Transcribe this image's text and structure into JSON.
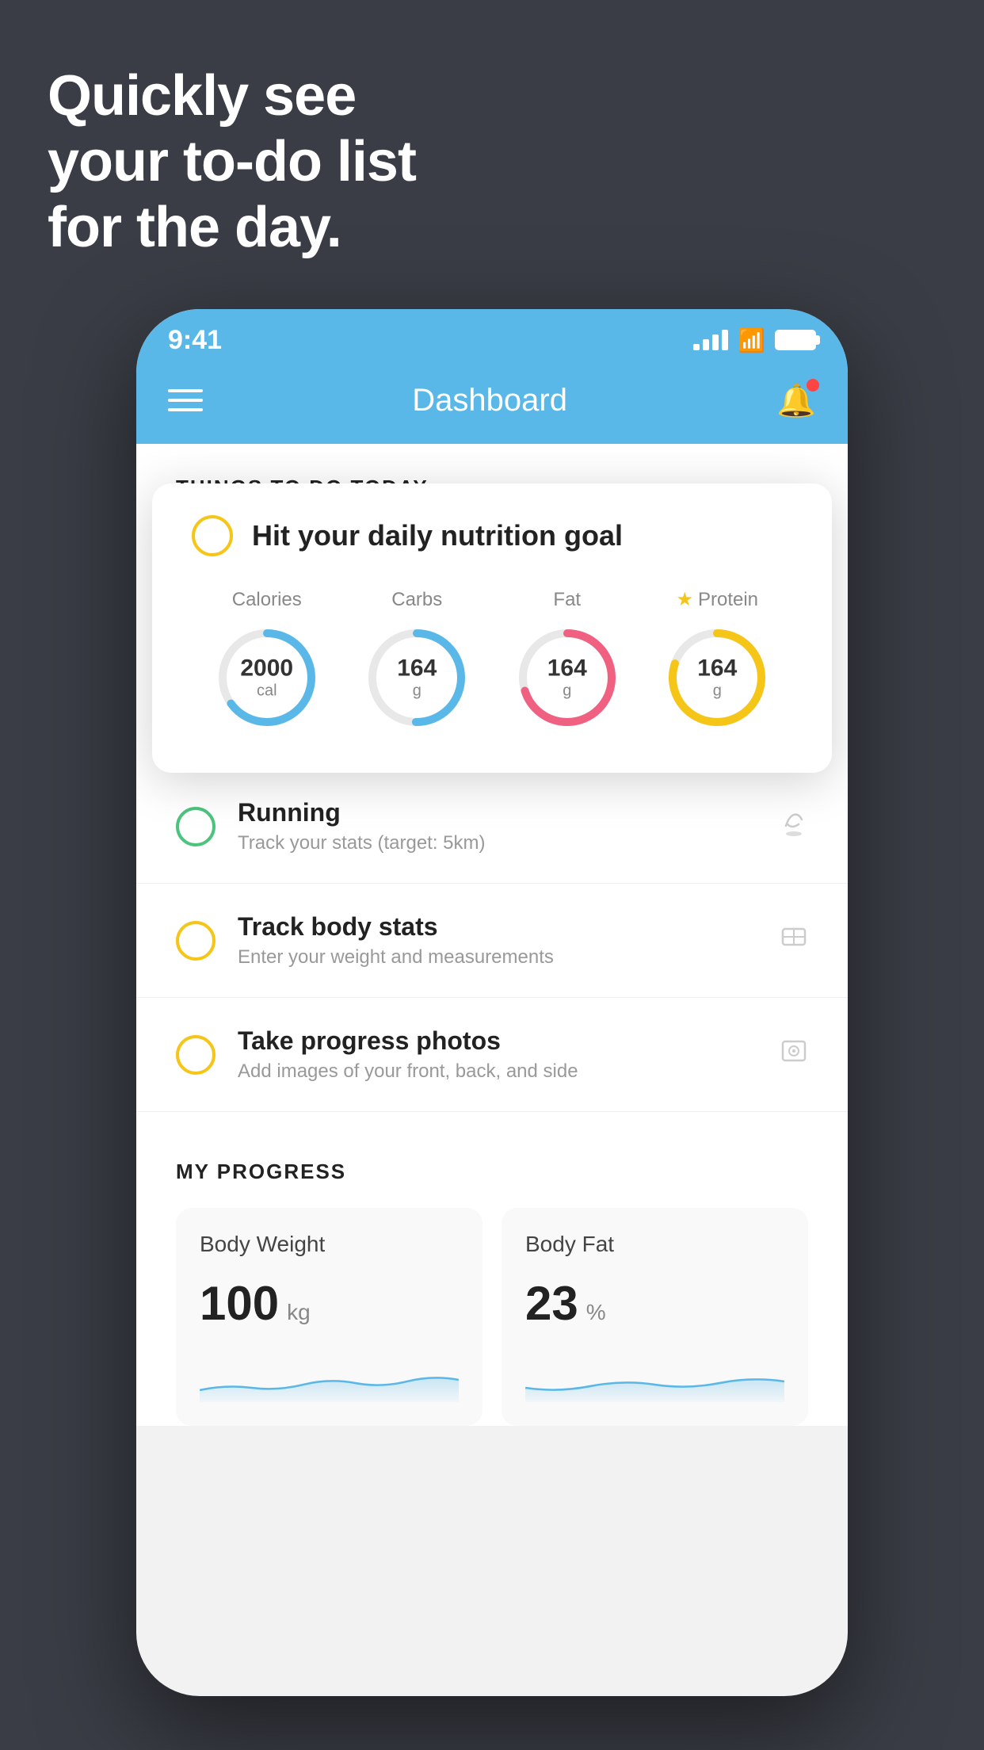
{
  "background_color": "#3a3d45",
  "hero": {
    "line1": "Quickly see",
    "line2": "your to-do list",
    "line3": "for the day."
  },
  "phone": {
    "status_bar": {
      "time": "9:41",
      "signal_bars": [
        12,
        18,
        24,
        30
      ],
      "battery_full": true
    },
    "nav": {
      "title": "Dashboard",
      "has_notification": true
    },
    "section_title": "THINGS TO DO TODAY",
    "floating_card": {
      "check_color": "#f5c518",
      "title": "Hit your daily nutrition goal",
      "nutrients": [
        {
          "label": "Calories",
          "value": "2000",
          "unit": "cal",
          "color": "#5ab8e8",
          "progress": 0.65
        },
        {
          "label": "Carbs",
          "value": "164",
          "unit": "g",
          "color": "#5ab8e8",
          "progress": 0.5
        },
        {
          "label": "Fat",
          "value": "164",
          "unit": "g",
          "color": "#f06080",
          "progress": 0.7
        },
        {
          "label": "Protein",
          "value": "164",
          "unit": "g",
          "color": "#f5c518",
          "progress": 0.8,
          "starred": true
        }
      ]
    },
    "todo_items": [
      {
        "id": "running",
        "title": "Running",
        "subtitle": "Track your stats (target: 5km)",
        "circle_color": "green",
        "icon": "👟"
      },
      {
        "id": "body-stats",
        "title": "Track body stats",
        "subtitle": "Enter your weight and measurements",
        "circle_color": "yellow",
        "icon": "⚖️"
      },
      {
        "id": "progress-photos",
        "title": "Take progress photos",
        "subtitle": "Add images of your front, back, and side",
        "circle_color": "yellow2",
        "icon": "👤"
      }
    ],
    "progress_section": {
      "title": "MY PROGRESS",
      "cards": [
        {
          "title": "Body Weight",
          "value": "100",
          "unit": "kg",
          "chart_color": "#5ab8e8"
        },
        {
          "title": "Body Fat",
          "value": "23",
          "unit": "%",
          "chart_color": "#5ab8e8"
        }
      ]
    }
  }
}
